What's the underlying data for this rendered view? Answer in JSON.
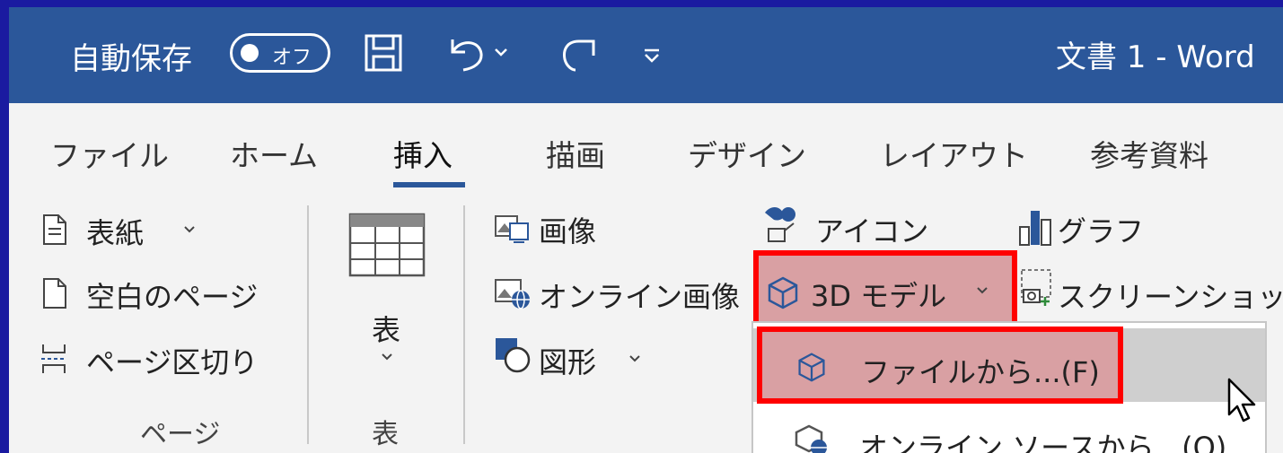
{
  "titlebar": {
    "autosave_label": "自動保存",
    "autosave_state": "オフ",
    "doc_title": "文書 1  -  Word"
  },
  "tabs": [
    "ファイル",
    "ホーム",
    "挿入",
    "描画",
    "デザイン",
    "レイアウト",
    "参考資料"
  ],
  "active_tab": "挿入",
  "groups": {
    "pages": {
      "label": "ページ",
      "items": [
        "表紙",
        "空白のページ",
        "ページ区切り"
      ]
    },
    "tables": {
      "label": "表",
      "button": "表"
    },
    "illustrations": {
      "image": "画像",
      "online_image": "オンライン画像",
      "shapes": "図形",
      "icons": "アイコン",
      "model3d": "3D モデル",
      "chart": "グラフ",
      "screenshot": "スクリーンショット"
    }
  },
  "dropdown": {
    "from_file": "ファイルから...(F)",
    "online_sources": "オンライン ソースから...(O)"
  },
  "colors": {
    "title_bar": "#2b579a",
    "ribbon_bg": "#f3f3f3",
    "highlight_border": "#ff0000",
    "highlight_fill": "#d9a0a3",
    "active_tab_underline": "#2b579a"
  }
}
